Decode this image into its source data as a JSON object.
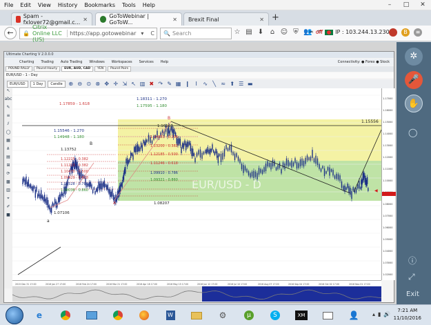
{
  "menubar": {
    "items": [
      "File",
      "Edit",
      "View",
      "History",
      "Bookmarks",
      "Tools",
      "Help"
    ]
  },
  "window_controls": {
    "minimize": "–",
    "maximize": "□",
    "close": "✕"
  },
  "tabs": [
    {
      "label": "Spam - fxlover72@gmail.c...",
      "active": false,
      "icon_color": "#d93025"
    },
    {
      "label": "GoToWebinar | GoToW...",
      "active": true,
      "icon_color": "#2c7a2c"
    },
    {
      "label": "Brexit Final",
      "active": false,
      "icon_color": "#9aa0a6"
    }
  ],
  "new_tab": "+",
  "urlbar": {
    "org": "Citrix Online LLC (US)",
    "url": "https://app.gotowebinar",
    "reload": "C"
  },
  "searchbar": {
    "placeholder": "Search"
  },
  "ipbox": {
    "status": "off",
    "ip": "IP : 103.244.13.230"
  },
  "right_panel": {
    "exit": "Exit"
  },
  "ultimate_charting": {
    "title": "Ultimate Charting V 2.0.0.0",
    "menu": [
      "Charting",
      "Trading",
      "Auto Trading",
      "Windows",
      "Workspaces",
      "Services",
      "Help"
    ],
    "connectivity": "Connectivity:  ● Forex  ● Stock",
    "chart_tabs": [
      "POUND RALLY",
      "Pound Hourly",
      "EUR, AUD, CAD",
      "YEN",
      "Pound Pairs"
    ],
    "active_chart_tab": 2,
    "subtitle": "EUR/USD - 1 - Day",
    "symbol": "EUR/USD",
    "interval": "1 Day",
    "chart_type": "Candle"
  },
  "chart": {
    "watermark": "EUR/USD - D",
    "labels": {
      "fib_top_1": "1.17859 - 1.618",
      "fib_top_2": "1.18311 - 1.270",
      "fib_top_3": "1.17595 - 1.180",
      "fib_mid_1": "1.15546 - 1.270",
      "fib_mid_2": "1.14948 - 1.180",
      "point_b_price": "1.13752",
      "fib_a_1": "1.12225 - 0.382",
      "fib_a_2": "1.11213 - 0.382",
      "fib_a_3": "1.10470 - 0.500",
      "fib_a_4": "1.09429 - 0.618",
      "fib_a_5": "1.08528 - 0.786",
      "fib_a_6": "1.08036 - 0.860",
      "point_a_price": "1.07106",
      "high_price": "1.16163",
      "fib_b_1": "1.14333 - 0.236",
      "fib_b_2": "1.13200 - 0.382",
      "fib_b_3": "1.12185 - 0.500",
      "fib_b_4": "1.11246 - 0.618",
      "fib_b_5": "1.09910 - 0.786",
      "fib_b_6": "1.09321 - 0.860",
      "low_price": "1.08207",
      "target": "1.15556",
      "point_a": "a",
      "point_b": "B",
      "point_A": "A",
      "point_B2": "B"
    },
    "price_axis": [
      "1.17000",
      "1.16000",
      "1.15000",
      "1.14000",
      "1.13000",
      "1.12000",
      "1.11000",
      "1.10000",
      "1.09000",
      "1.08000",
      "1.07000",
      "1.06000",
      "1.05000",
      "1.04000",
      "1.03000",
      "1.02000"
    ],
    "time_axis": [
      "2015 Dec 31 17:00",
      "2016 Jan 27 17:00",
      "2016 Feb 24 17:00",
      "2016 Mar 21 17:00",
      "2016 Apr 18 17:00",
      "2016 May 15 17:00",
      "2016 Jun 12 17:00",
      "2016 Jul 10 17:00",
      "2016 Aug 07 17:00",
      "2016 Sep 04 17:00",
      "2016 Oct 02 17:00",
      "2016 Nov 01 17:00"
    ],
    "current_price_color": "#d21a1a",
    "accent_yellow": "#f4f2a4",
    "accent_green": "#bfe3a6"
  },
  "taskbar": {
    "apps": [
      "ie-icon",
      "chrome-icon",
      "paint-icon",
      "chrome-icon-2",
      "firefox-icon",
      "word-icon",
      "folder-icon",
      "settings-icon",
      "torrent-icon",
      "skype-icon",
      "xm-icon",
      "mail-icon",
      "people-icon"
    ],
    "time": "7:21 AM",
    "date": "11/10/2016"
  }
}
